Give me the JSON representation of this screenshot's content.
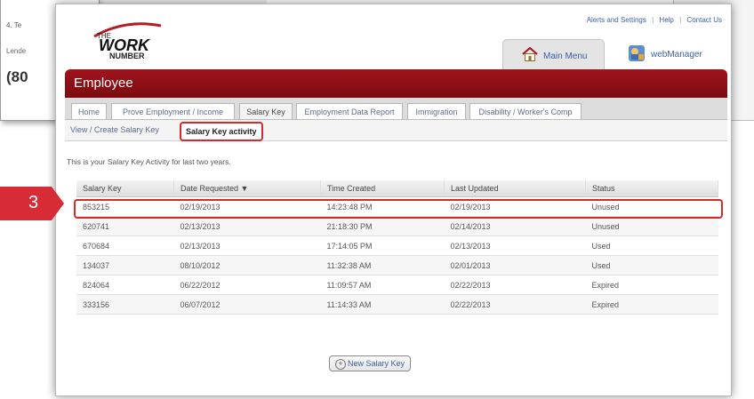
{
  "background_doc": {
    "item_text": "4.  Te",
    "lender_text": "Lende",
    "phone_text": "(80"
  },
  "top_links": {
    "alerts": "Alerts and Settings",
    "help": "Help",
    "contact": "Contact Us",
    "separator": "|"
  },
  "logo": {
    "line1": "THE",
    "line2": "WORK",
    "line3": "NUMBER"
  },
  "header_tabs": {
    "main_menu": "Main Menu",
    "web_manager": "webManager"
  },
  "section_title": "Employee",
  "nav_tabs": [
    {
      "label": "Home"
    },
    {
      "label": "Prove Employment / Income"
    },
    {
      "label": "Salary Key"
    },
    {
      "label": "Employment Data Report"
    },
    {
      "label": "Immigration"
    },
    {
      "label": "Disability / Worker's Comp"
    }
  ],
  "subnav": {
    "view_create": "View / Create Salary Key",
    "activity": "Salary Key activity"
  },
  "intro_text": "This is your Salary Key Activity for last two years.",
  "table": {
    "headers": [
      "Salary Key",
      "Date Requested ▼",
      "Time Created",
      "Last Updated",
      "Status"
    ],
    "rows": [
      [
        "853215",
        "02/19/2013",
        "14:23:48 PM",
        "02/19/2013",
        "Unused"
      ],
      [
        "620741",
        "02/13/2013",
        "21:18:30 PM",
        "02/14/2013",
        "Unused"
      ],
      [
        "670684",
        "02/13/2013",
        "17:14:05 PM",
        "02/13/2013",
        "Used"
      ],
      [
        "134037",
        "08/10/2012",
        "11:32:38 AM",
        "02/01/2013",
        "Used"
      ],
      [
        "824064",
        "06/22/2012",
        "11:09:57 AM",
        "02/22/2013",
        "Expired"
      ],
      [
        "333156",
        "06/07/2012",
        "11:14:33 AM",
        "02/22/2013",
        "Expired"
      ]
    ]
  },
  "callout_number": "3",
  "new_button": {
    "label": "New Salary Key",
    "icon": "+"
  },
  "colors": {
    "brand_red": "#8e1016",
    "highlight_red": "#d42a2a",
    "unused": "#5a8a3a",
    "expired": "#c0485a"
  }
}
